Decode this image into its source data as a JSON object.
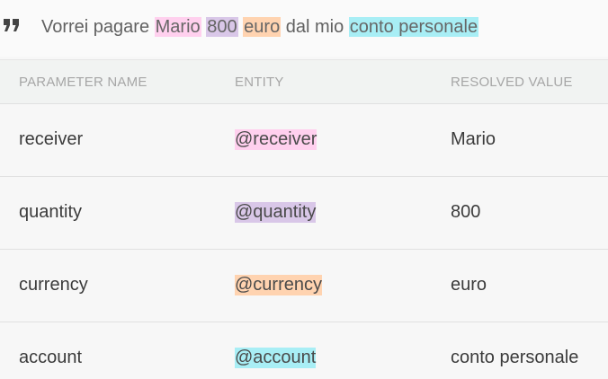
{
  "utterance": {
    "segments": [
      {
        "text": "Vorrei pagare ",
        "highlight": null
      },
      {
        "text": "Mario",
        "highlight": "#ffd0ee"
      },
      {
        "text": " ",
        "highlight": null
      },
      {
        "text": "800",
        "highlight": "#d9c7e8"
      },
      {
        "text": " ",
        "highlight": null
      },
      {
        "text": "euro",
        "highlight": "#ffd3b0"
      },
      {
        "text": " dal mio ",
        "highlight": null
      },
      {
        "text": "conto personale",
        "highlight": "#a8eef5"
      }
    ]
  },
  "table": {
    "headers": [
      "PARAMETER NAME",
      "ENTITY",
      "RESOLVED VALUE"
    ],
    "rows": [
      {
        "parameter": "receiver",
        "entity": "@receiver",
        "entity_color": "#ffd0ee",
        "value": "Mario"
      },
      {
        "parameter": "quantity",
        "entity": "@quantity",
        "entity_color": "#d9c7e8",
        "value": "800"
      },
      {
        "parameter": "currency",
        "entity": "@currency",
        "entity_color": "#ffd3b0",
        "value": "euro"
      },
      {
        "parameter": "account",
        "entity": "@account",
        "entity_color": "#a8eef5",
        "value": "conto personale"
      }
    ]
  },
  "icons": {
    "quote": "format-quote-icon"
  }
}
